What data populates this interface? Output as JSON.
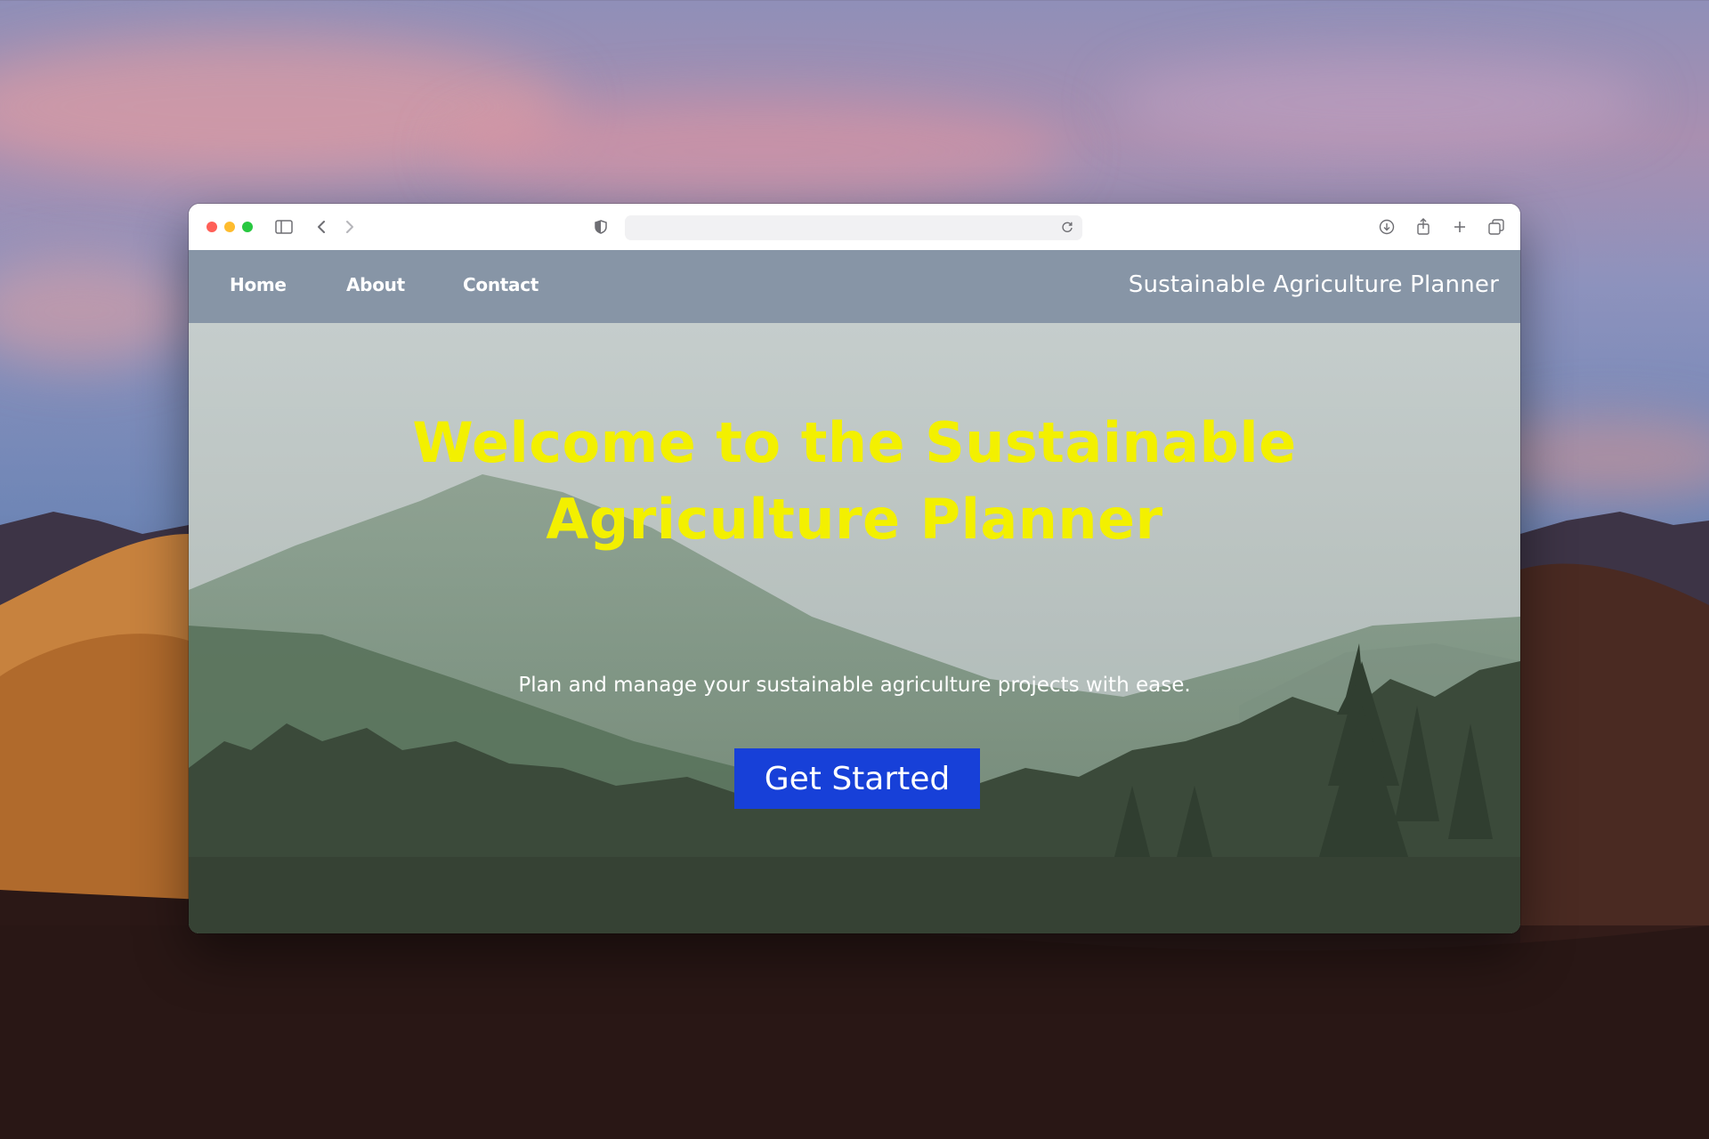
{
  "desktop": {
    "wallpaper": "macOS Mojave desert dunes at dusk"
  },
  "browser": {
    "traffic_lights": {
      "close_color": "#ff5f57",
      "minimize_color": "#febc2e",
      "zoom_color": "#28c840"
    },
    "toolbar_icons": [
      "sidebar-icon",
      "back-icon",
      "forward-icon",
      "shield-icon",
      "reload-icon",
      "download-icon",
      "share-icon",
      "new-tab-icon",
      "tabs-overview-icon"
    ],
    "url": ""
  },
  "site": {
    "nav": {
      "items": [
        {
          "label": "Home"
        },
        {
          "label": "About"
        },
        {
          "label": "Contact"
        }
      ],
      "title": "Sustainable Agriculture Planner",
      "background_color": "#8795a6"
    },
    "hero": {
      "title": "Welcome to the Sustainable Agriculture Planner",
      "subtitle": "Plan and manage your sustainable agriculture projects with ease.",
      "cta_label": "Get Started",
      "title_color": "#f3f000",
      "cta_color": "#1740d8"
    }
  }
}
